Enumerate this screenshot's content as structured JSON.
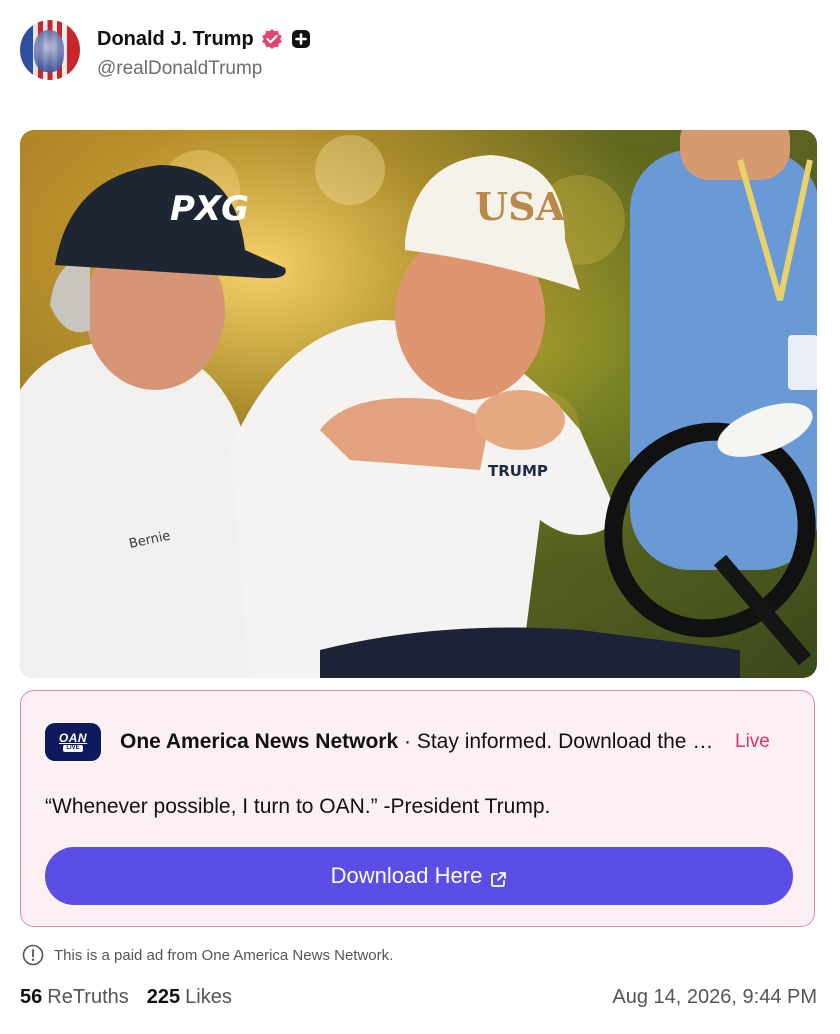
{
  "post": {
    "author": {
      "display_name": "Donald J. Trump",
      "handle": "@realDonaldTrump",
      "verified_icon": "verified-badge-icon",
      "plus_icon": "plus-badge-icon"
    },
    "image": {
      "cap_text_left": "PXG",
      "cap_text_right": "USA",
      "shirt_text_left": "Bernie",
      "shirt_text_right": "TRUMP"
    },
    "stats": {
      "retruths_count": "56",
      "retruths_label": "ReTruths",
      "likes_count": "225",
      "likes_label": "Likes"
    },
    "timestamp": "Aug 14, 2026, 9:44 PM"
  },
  "ad": {
    "logo_text": "OAN",
    "logo_subtext": "LIVE",
    "source": "One America News Network",
    "separator": " · ",
    "tagline": "Stay informed. Download the app",
    "status": "Live",
    "quote": "“Whenever possible, I turn to OAN.” -President Trump.",
    "button_label": "Download Here",
    "disclaimer": "This is a paid ad from One America News Network."
  },
  "colors": {
    "accent": "#5b4ee6",
    "live": "#d9346b",
    "ad_border": "#e58ca4",
    "ad_bg": "#fdf0f3",
    "verified": "#e0466e"
  }
}
